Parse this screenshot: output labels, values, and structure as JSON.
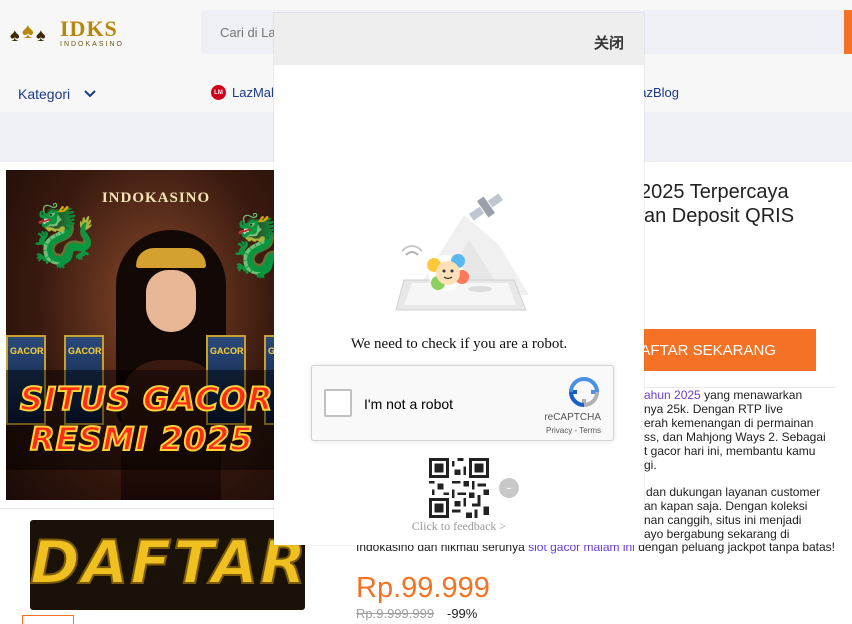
{
  "header": {
    "logo": {
      "brand": "IDKS",
      "tagline": "INDOKASINO"
    },
    "search": {
      "placeholder": "Cari di Lazada"
    }
  },
  "nav": {
    "category_label": "Kategori",
    "links": [
      {
        "label": "LazMall",
        "icon": "lazmall-icon"
      },
      {
        "label": "LazBlog"
      }
    ]
  },
  "product": {
    "image_texts": {
      "brand": "INDOKASINO",
      "slot_label": "GACOR",
      "line1": "SITUS GACOR",
      "line2": "RESMI 2025"
    },
    "banner_text": "DAFTAR",
    "title_lines": [
      "2025 Terpercaya",
      "an Deposit QRIS"
    ],
    "cta_label": "AFTAR SEKARANG",
    "description": [
      {
        "text": "yang menawarkan",
        "link": "ahun 2025"
      },
      {
        "text": "nya 25k. Dengan RTP live"
      },
      {
        "text": "erah kemenangan di permainan"
      },
      {
        "text": "ss, dan Mahjong Ways 2. Sebagai"
      },
      {
        "text": "t gacor hari ini, membantu kamu"
      },
      {
        "text": "gi."
      },
      {
        "text": "dan dukungan layanan customer"
      },
      {
        "text": "an kapan saja. Dengan koleksi"
      },
      {
        "text": "nan canggih, situs ini menjadi"
      },
      {
        "text": "ayo bergabung sekarang di"
      },
      {
        "text": "Indokasino dan nikmati serunya",
        "link": "slot gacor malam ini",
        "tail": "dengan peluang jackpot tanpa batas!"
      }
    ],
    "price": "Rp.99.999",
    "price_original": "Rp.9.999.999",
    "discount": "-99%"
  },
  "captcha_modal": {
    "close_label": "关闭",
    "message": "We need to check if you are a robot.",
    "recaptcha": {
      "checkbox_label": "I'm not a robot",
      "brand": "reCAPTCHA",
      "links": "Privacy - Terms"
    },
    "minus_label": "-",
    "feedback_label": "Click to feedback >"
  },
  "colors": {
    "accent": "#f57224",
    "nav_text": "#1a3a8a",
    "link": "#6a3fd8"
  }
}
